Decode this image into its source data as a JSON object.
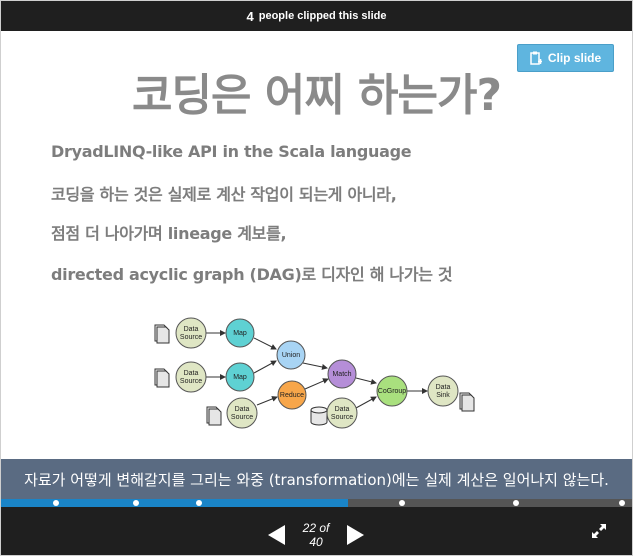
{
  "header": {
    "clip_count": "4",
    "clip_text": "people clipped this slide"
  },
  "clip_button": {
    "label": "Clip slide",
    "icon": "clip-icon"
  },
  "slide": {
    "title": "코딩은 어찌 하는가?",
    "lines": [
      "DryadLINQ-like API in the Scala language",
      "코딩을 하는 것은 실제로 계산 작업이 되는게 아니라,",
      "점점 더 나아가며 lineage 계보를,",
      "directed acyclic graph (DAG)로 디자인 해 나가는 것"
    ],
    "diagram": {
      "nodes": {
        "source1": [
          "Data",
          "Source"
        ],
        "source2": [
          "Data",
          "Source"
        ],
        "source3": [
          "Data",
          "Source"
        ],
        "source4": [
          "Data",
          "Source"
        ],
        "map1": "Map",
        "map2": "Map",
        "union": "Union",
        "reduce": "Reduce",
        "match": "Match",
        "cogroup": "CoGroup",
        "sink": [
          "Data",
          "Sink"
        ]
      },
      "colors": {
        "source": "#dfe6c4",
        "map": "#5ed1d3",
        "union": "#a8d4f4",
        "reduce": "#f7a64a",
        "match": "#b58ed8",
        "cogroup": "#a9e07e",
        "sink": "#dfe6c4"
      }
    },
    "caption": "자료가 어떻게 변해갈지를 그리는 와중 (transformation)에는 실제 계산은 일어나지 않는다."
  },
  "progress": {
    "fraction": 0.55,
    "accent": "#1a84c7"
  },
  "navigation": {
    "counter": "22 of 40",
    "current": 22,
    "total": 40,
    "prev_icon": "prev-arrow-icon",
    "next_icon": "next-arrow-icon",
    "fullscreen_icon": "fullscreen-icon"
  }
}
